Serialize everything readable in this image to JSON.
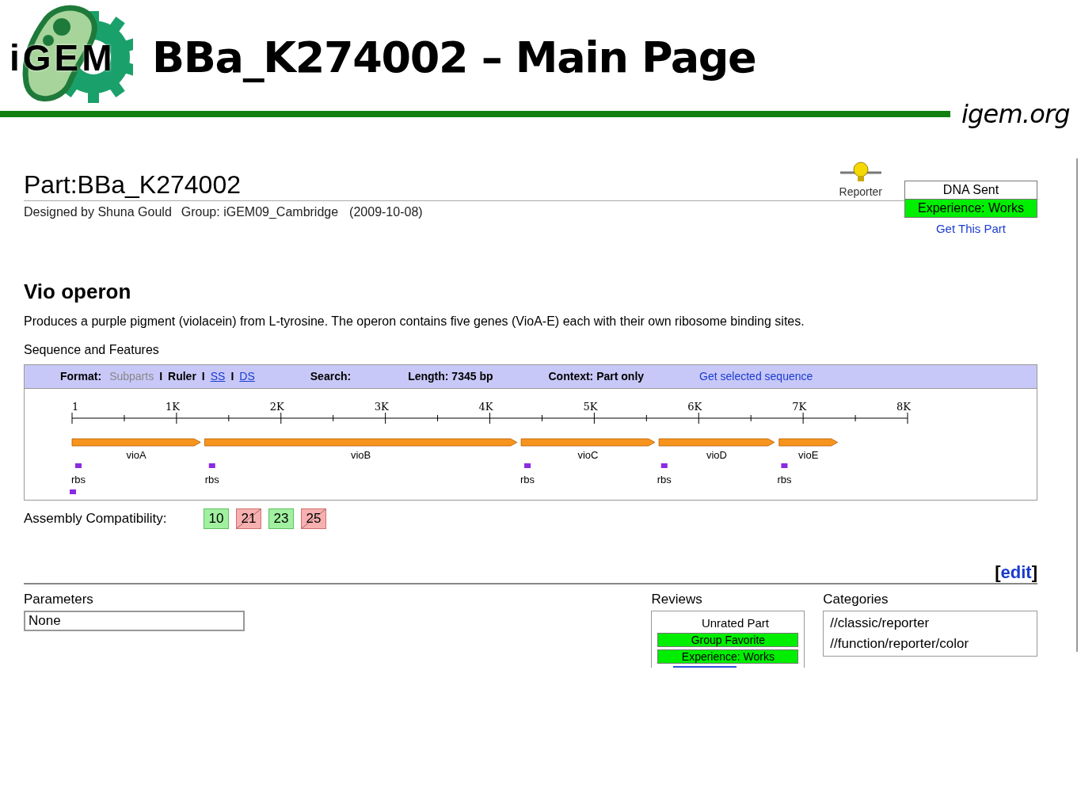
{
  "slide": {
    "logo_text": "iGEM",
    "title": "BBa_K274002 – Main Page",
    "site": "igem.org"
  },
  "part": {
    "title": "Part:BBa_K274002",
    "designer": "Designed by Shuna Gould",
    "group": "Group: iGEM09_Cambridge",
    "date": "(2009-10-08)",
    "type_label": "Reporter",
    "status": [
      {
        "label": "DNA Sent",
        "kind": "plain"
      },
      {
        "label": "Experience: Works",
        "kind": "good"
      }
    ],
    "get_link": "Get This Part"
  },
  "name": "Vio operon",
  "description": "Produces a purple pigment (violacein) from L-tyrosine. The operon contains five genes (VioA-E) each with their own ribosome binding sites.",
  "sequence_heading": "Sequence and Features",
  "toolbar": {
    "format_label": "Format:",
    "subparts": "Subparts",
    "ruler": "Ruler",
    "seps": [
      "I",
      "I",
      "I"
    ],
    "ss": "SS",
    "ds": "DS",
    "search": "Search:",
    "length": "Length: 7345 bp",
    "context": "Context: Part only",
    "get_selected": "Get selected sequence"
  },
  "ruler_labels": [
    "1",
    "1K",
    "2K",
    "3K",
    "4K",
    "5K",
    "6K",
    "7K",
    "8K"
  ],
  "genes": [
    {
      "name": "vioA"
    },
    {
      "name": "vioB"
    },
    {
      "name": "vioC"
    },
    {
      "name": "vioD"
    },
    {
      "name": "vioE"
    }
  ],
  "rbs": [
    {
      "name": "rbs"
    },
    {
      "name": "rbs"
    },
    {
      "name": "rbs"
    },
    {
      "name": "rbs"
    },
    {
      "name": "rbs"
    }
  ],
  "assembly": {
    "label": "Assembly Compatibility:",
    "standards": [
      {
        "label": "10",
        "compatible": true
      },
      {
        "label": "21",
        "compatible": false
      },
      {
        "label": "23",
        "compatible": true
      },
      {
        "label": "25",
        "compatible": false
      }
    ]
  },
  "edit": {
    "open": "[",
    "link": "edit",
    "close": "]"
  },
  "parameters": {
    "heading": "Parameters",
    "value": "None"
  },
  "reviews": {
    "heading": "Reviews",
    "rating": "Unrated Part",
    "badges": [
      "Group Favorite",
      "Experience: Works"
    ]
  },
  "categories": {
    "heading": "Categories",
    "items": [
      "//classic/reporter",
      "//function/reporter/color"
    ]
  }
}
